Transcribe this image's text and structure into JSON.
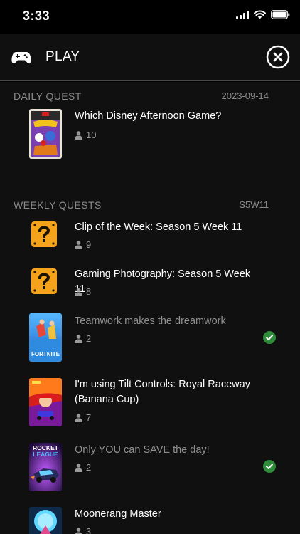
{
  "status": {
    "time": "3:33"
  },
  "header": {
    "title": "PLAY"
  },
  "daily": {
    "title": "DAILY QUEST",
    "date": "2023-09-14",
    "quests": [
      {
        "title": "Which Disney Afternoon Game?",
        "players": "10",
        "completed": false,
        "thumb": "ducktales-cover"
      }
    ]
  },
  "weekly": {
    "title": "WEEKLY QUESTS",
    "code": "S5W11",
    "quests": [
      {
        "title": "Clip of the Week: Season 5 Week 11",
        "players": "9",
        "completed": false,
        "thumb": "question-block"
      },
      {
        "title": "Gaming Photography: Season 5 Week 11",
        "players": "8",
        "completed": false,
        "thumb": "question-block"
      },
      {
        "title": "Teamwork makes the dreamwork",
        "players": "2",
        "completed": true,
        "thumb": "fortnite-cover"
      },
      {
        "title": "I'm using Tilt Controls: Royal Raceway (Banana Cup)",
        "players": "7",
        "completed": false,
        "thumb": "mario-kart-cover"
      },
      {
        "title": "Only YOU can SAVE the day!",
        "players": "2",
        "completed": true,
        "thumb": "rocket-league-cover"
      },
      {
        "title": "Moonerang Master",
        "players": "3",
        "completed": false,
        "thumb": "moon-cover"
      }
    ]
  },
  "thumb_text": {
    "fortnite": "FORTNITE",
    "rocket": "ROCKET",
    "league": "LEAGUE"
  },
  "colors": {
    "background": "#101010",
    "check": "#2e8b3a",
    "question_block": "#f5a31a",
    "muted": "#8a8a8a"
  }
}
